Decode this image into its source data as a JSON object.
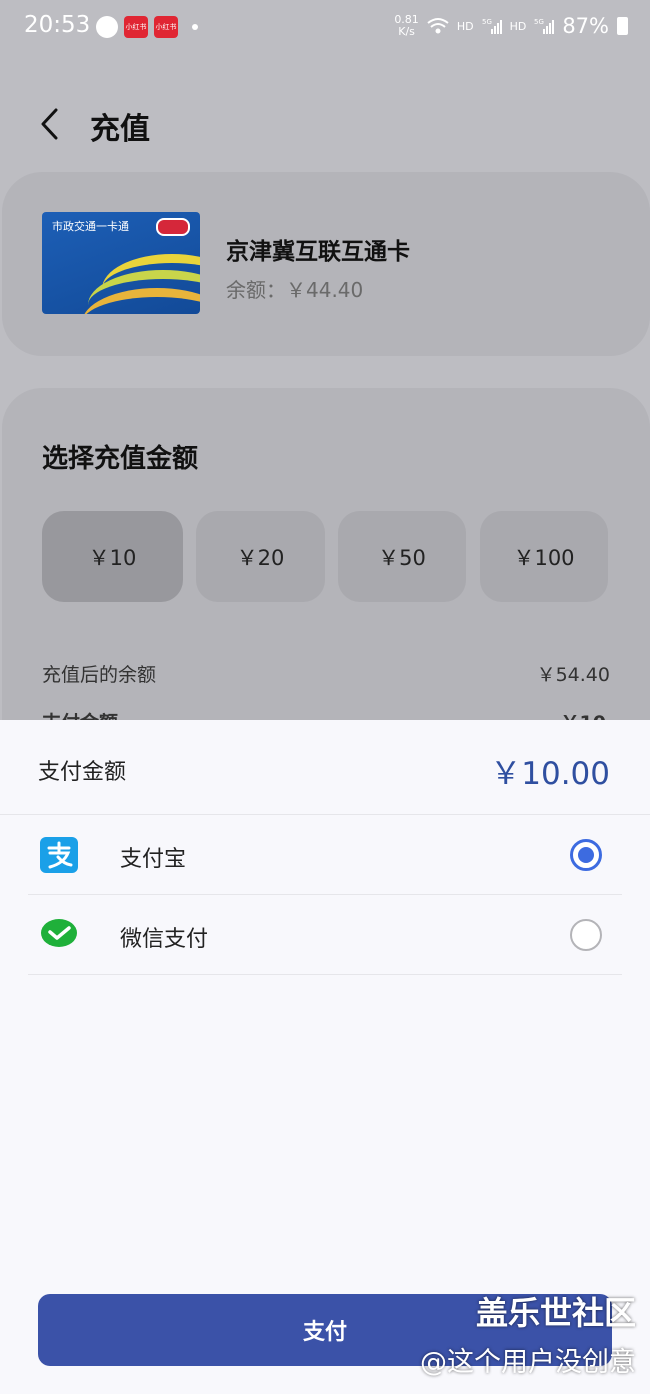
{
  "status_bar": {
    "time": "20:53",
    "speed_value": "0.81",
    "speed_unit": "K/s",
    "hd1": "HD",
    "net1": "5G",
    "hd2": "HD",
    "net2": "5G",
    "battery": "87%",
    "app_badge": "小红书"
  },
  "header": {
    "title": "充值",
    "back_icon": "chevron-left-icon"
  },
  "card": {
    "name": "京津冀互联互通卡",
    "balance": "余额：￥44.40",
    "image_text": "市政交通一卡通"
  },
  "amount_section": {
    "title": "选择充值金额",
    "options": [
      {
        "label": "￥10",
        "selected": true
      },
      {
        "label": "￥20",
        "selected": false
      },
      {
        "label": "￥50",
        "selected": false
      },
      {
        "label": "￥100",
        "selected": false
      }
    ],
    "after_label": "充值后的余额",
    "after_value": "￥54.40",
    "pay_label": "支付金额",
    "pay_value": "￥10"
  },
  "sheet": {
    "pay_label": "支付金额",
    "pay_amount": "￥10.00",
    "methods": [
      {
        "label": "支付宝",
        "icon": "alipay-icon",
        "checked": true
      },
      {
        "label": "微信支付",
        "icon": "wechat-pay-icon",
        "checked": false
      }
    ],
    "pay_button": "支付"
  },
  "watermark": {
    "title": "盖乐世社区",
    "subtitle": "@这个用户没创意"
  },
  "colors": {
    "accent": "#3b52a8",
    "amount_text": "#2f4fa0",
    "radio_active": "#3d6be0",
    "alipay": "#1aa0e8",
    "wechat": "#1fb03a"
  }
}
